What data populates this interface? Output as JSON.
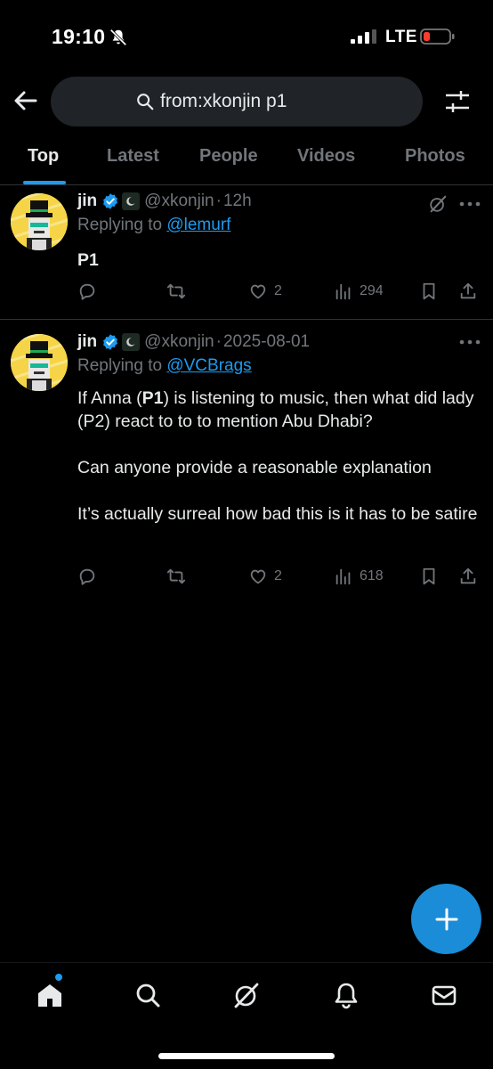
{
  "status": {
    "time": "19:10",
    "network": "LTE"
  },
  "search": {
    "query": "from:xkonjin p1"
  },
  "tabs": [
    {
      "label": "Top",
      "active": true
    },
    {
      "label": "Latest"
    },
    {
      "label": "People"
    },
    {
      "label": "Videos"
    },
    {
      "label": "Photos"
    }
  ],
  "tweets": [
    {
      "name": "jin",
      "handle": "@xkonjin",
      "dot": "·",
      "time": "12h",
      "reply_prefix": "Replying to",
      "reply_to": "@lemurf",
      "body": "P1",
      "likes": "2",
      "views": "294"
    },
    {
      "name": "jin",
      "handle": "@xkonjin",
      "dot": "·",
      "time": "2025-08-01",
      "reply_prefix": "Replying to",
      "reply_to": "@VCBrags",
      "p1_a": "If Anna (",
      "p1_b": "P1",
      "p1_c": ") is listening to music, then what did lady (P2) react to to to mention Abu Dhabi?",
      "p2": "Can anyone provide a reasonable explanation",
      "p3": "It’s actually surreal how bad this is it has to be satire",
      "likes": "2",
      "views": "618"
    }
  ],
  "colors": {
    "accent": "#1d9bf0",
    "muted": "#71767b",
    "text": "#e7e9ea",
    "divider": "#2f3336",
    "fab": "#1a8cd8"
  },
  "icons": [
    "back-arrow-icon",
    "search-icon",
    "filter-icon",
    "verified-icon",
    "reply-icon",
    "retweet-icon",
    "like-icon",
    "views-icon",
    "bookmark-icon",
    "share-icon",
    "grok-icon",
    "more-icon",
    "compose-icon",
    "home-icon",
    "explore-icon",
    "notifications-icon",
    "messages-icon"
  ]
}
